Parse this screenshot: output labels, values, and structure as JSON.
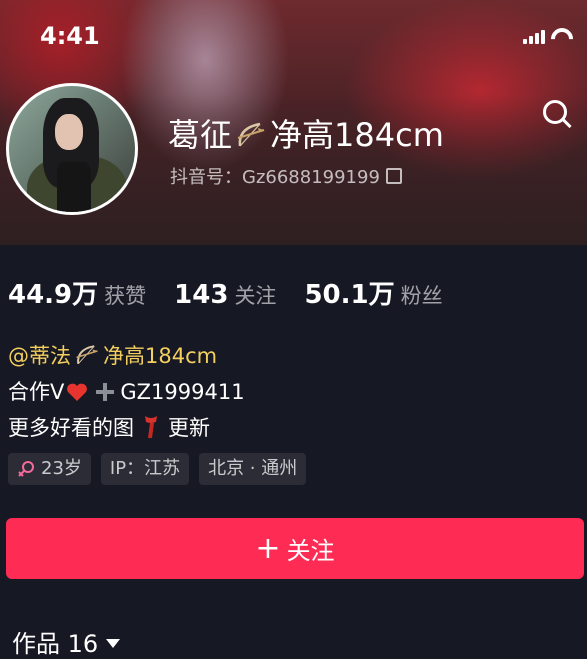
{
  "status_bar": {
    "time": "4:41"
  },
  "profile": {
    "name_part1": "葛征",
    "name_part2": "净高184cm",
    "douyin_id": "抖音号：Gz6688199199"
  },
  "stats": [
    {
      "value": "44.9万",
      "label": "获赞"
    },
    {
      "value": "143",
      "label": "关注"
    },
    {
      "value": "50.1万",
      "label": "粉丝"
    }
  ],
  "bio": {
    "mention_part1": "@蒂法",
    "mention_part2": "净高184cm",
    "line2_prefix": "合作V",
    "line2_code": "GZ1999411",
    "line3_part1": "更多好看的图",
    "line3_part2": "更新"
  },
  "tags": [
    {
      "text": "23岁",
      "icon": "female-icon"
    },
    {
      "text": "IP：江苏"
    },
    {
      "text": "北京 · 通州"
    }
  ],
  "follow_button": {
    "plus": "+",
    "label": "关注"
  },
  "works_tab": {
    "label": "作品",
    "count": "16"
  },
  "colors": {
    "accent": "#fe2c55",
    "background": "#161823",
    "mention": "#f4cf5e"
  },
  "icons": [
    "back-icon",
    "search-icon",
    "bow-arrow-icon",
    "copy-icon",
    "heart-icon",
    "plus-icon",
    "scarf-icon",
    "female-icon",
    "caret-down-icon"
  ]
}
